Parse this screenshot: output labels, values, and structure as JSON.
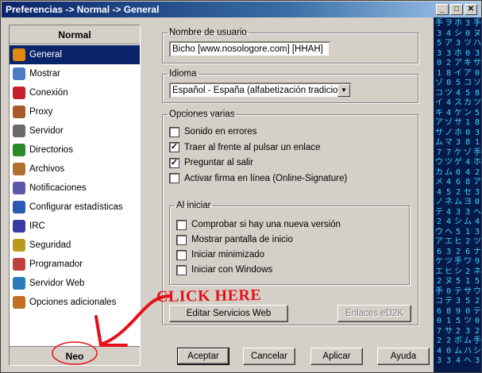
{
  "window": {
    "title": "Preferencias -> Normal -> General"
  },
  "title_buttons": [
    "_",
    "□",
    "✕"
  ],
  "sidebar": {
    "header": "Normal",
    "footer": "Neo",
    "items": [
      {
        "label": "General",
        "icon": "gear-icon",
        "color": "#e08a10"
      },
      {
        "label": "Mostrar",
        "icon": "monitor-icon",
        "color": "#4c7cc4"
      },
      {
        "label": "Conexión",
        "icon": "plug-icon",
        "color": "#c8202a"
      },
      {
        "label": "Proxy",
        "icon": "proxy-icon",
        "color": "#a85a2a"
      },
      {
        "label": "Servidor",
        "icon": "server-icon",
        "color": "#6a6a6a"
      },
      {
        "label": "Directorios",
        "icon": "folder-tree-icon",
        "color": "#2a8a2a"
      },
      {
        "label": "Archivos",
        "icon": "files-icon",
        "color": "#b07030"
      },
      {
        "label": "Notificaciones",
        "icon": "notification-icon",
        "color": "#5a5aa8"
      },
      {
        "label": "Configurar estadísticas",
        "icon": "stats-icon",
        "color": "#2a5ab0"
      },
      {
        "label": "IRC",
        "icon": "irc-icon",
        "color": "#3a3aa0"
      },
      {
        "label": "Seguridad",
        "icon": "lock-icon",
        "color": "#b89a20"
      },
      {
        "label": "Programador",
        "icon": "calendar-icon",
        "color": "#c04040"
      },
      {
        "label": "Servidor Web",
        "icon": "globe-icon",
        "color": "#2a7ab8"
      },
      {
        "label": "Opciones adicionales",
        "icon": "advanced-icon",
        "color": "#c07020"
      }
    ]
  },
  "username": {
    "legend": "Nombre de usuario",
    "value": "Bicho [www.nosologore.com] [HHAH]"
  },
  "language": {
    "legend": "Idioma",
    "value": "Español - España (alfabetización tradicional"
  },
  "options": {
    "legend": "Opciones varias",
    "items": [
      {
        "label": "Sonido en errores",
        "checked": false
      },
      {
        "label": "Traer al frente al pulsar un enlace",
        "checked": true
      },
      {
        "label": "Preguntar al salir",
        "checked": true
      },
      {
        "label": "Activar firma en línea (Online-Signature)",
        "checked": false
      }
    ]
  },
  "startup": {
    "legend": "Al iniciar",
    "items": [
      {
        "label": "Comprobar si hay una nueva versión",
        "checked": false
      },
      {
        "label": "Mostrar pantalla de inicio",
        "checked": false
      },
      {
        "label": "Iniciar minimizado",
        "checked": false
      },
      {
        "label": "Iniciar con Windows",
        "checked": false
      }
    ]
  },
  "buttons": {
    "web_services": "Editar Servicios Web",
    "ed2k_links": "Enlaces eD2K",
    "accept": "Aceptar",
    "cancel": "Cancelar",
    "apply": "Aplicar",
    "help": "Ayuda"
  },
  "annotation": {
    "text": "CLICK HERE",
    "color": "#e6101a"
  },
  "matrix_columns": [
    "手\n3\n5\n3\n0\n1\nゾ\nコ\nイ\nキ\nア\nサ\nム\n7\nウ\nカ\nメ\n4\nノ\nテ\n2\nウ\nア\n6\nケ\nエ\n2\n手\nコ\n6\n0\n7\n2\n4\n3",
    "ヲ\n4\nア\n3\n2\n8\n0\nツ\n4\n4\nゾ\nノ\nマ\n7\nツ\nム\n4\n5\nネ\n4\n4\nヘ\nエ\n3\nツ\nヒ\nヌ\n0\nテ\n8\n1\nサ\n2\n0\n3",
    "ホ\nシ\n3\nホ\nア\nイ\n5\n4\nス\nケ\nサ\nホ\n3\nケ\nゲ\n0\n6\n2\nム\n3\nシ\n5\nヒ\n2\n手\nシ\n5\nテ\n3\n9\n5\n2\nボ\nム\n4",
    "3\n0\nツ\n0\nキ\nア\nコ\n5\nカ\nン\n1\n0\n8\nゾ\n4\n4\n8\nセ\nヨ\n3\nム\n1\n2\n6\nワ\n2\n1\nサ\n5\n0\nツ\n3\nム\nハ\nヘ",
    "手\nヌ\nハ\n3\nサ\n0\nソ\n8\nツ\n5\n8\n3\n1\n手\nホ\n2\nア\n3\n0\nヘ\n4\n3\nツ\nナ\n9\nネ\n5\nウ\n2\nテ\n0\n2\n手\nシ\n3"
  ]
}
